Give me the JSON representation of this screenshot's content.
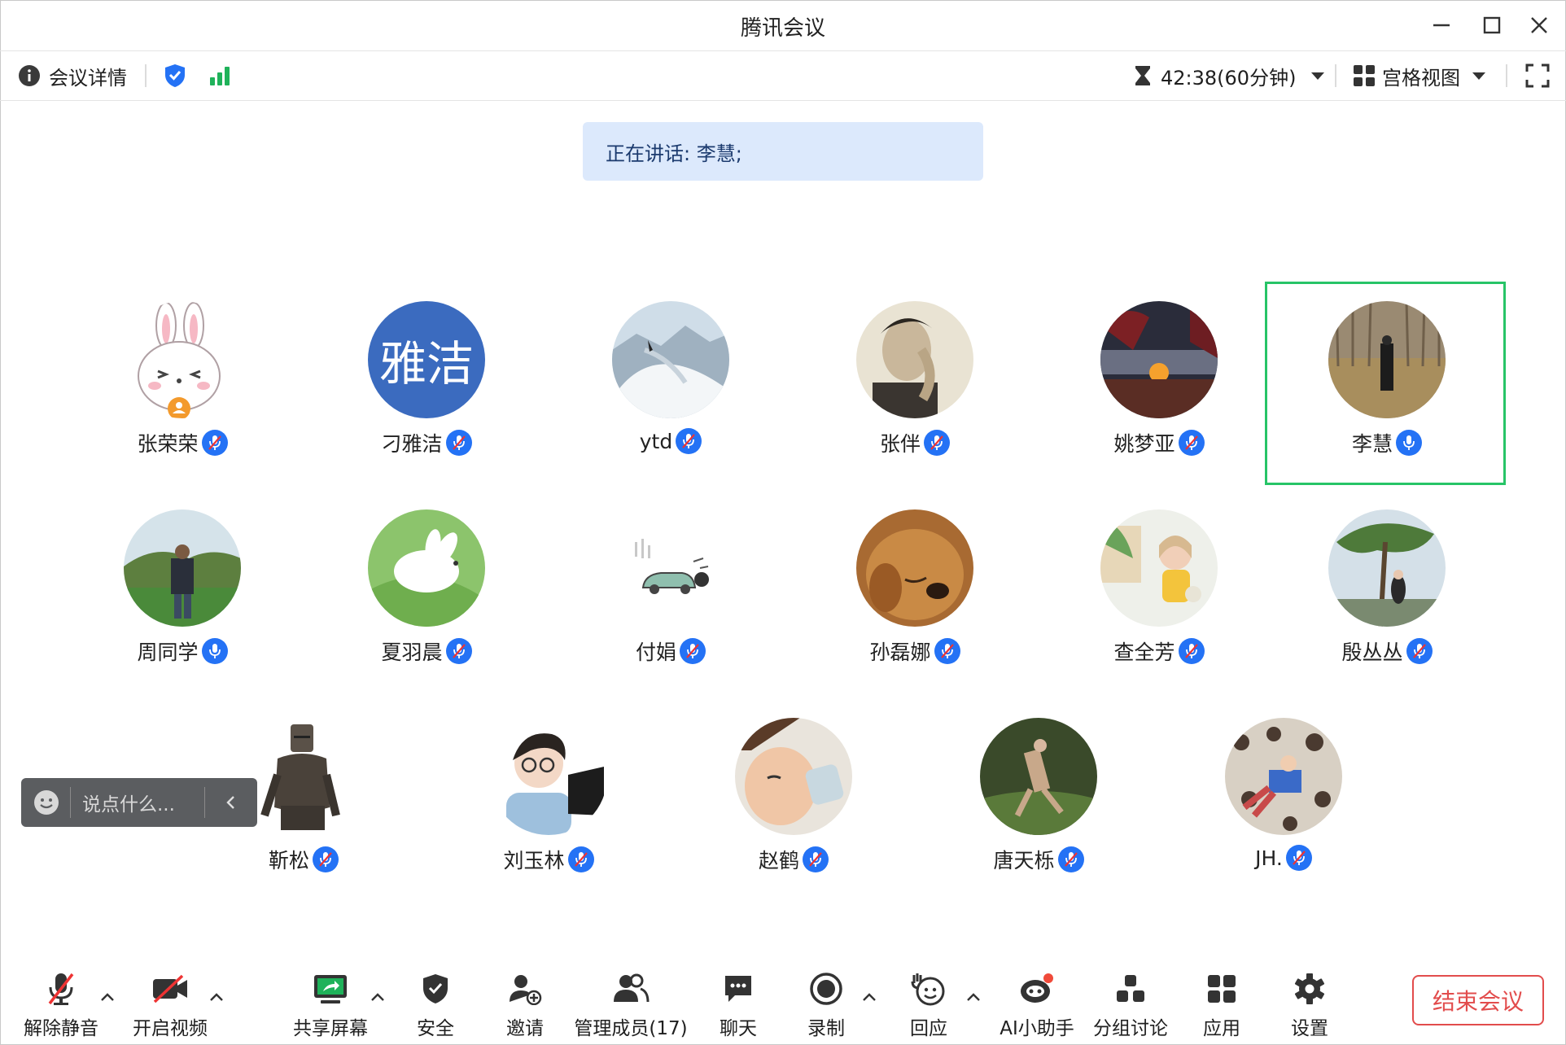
{
  "window": {
    "title": "腾讯会议"
  },
  "topbar": {
    "meeting_details": "会议详情",
    "timer": "42:38(60分钟)",
    "view_mode": "宫格视图"
  },
  "speaking": {
    "text": "正在讲话: 李慧;"
  },
  "participants": [
    {
      "name": "张荣荣",
      "mic": "muted",
      "avatar": "cartoon-rabbit"
    },
    {
      "name": "刁雅洁",
      "mic": "muted",
      "avatar": "text",
      "avatar_text": "雅洁",
      "avatar_color": "#3b6bbf"
    },
    {
      "name": "ytd",
      "mic": "muted",
      "avatar": "snow-mountain"
    },
    {
      "name": "张伴",
      "mic": "muted",
      "avatar": "man-portrait"
    },
    {
      "name": "姚梦亚",
      "mic": "muted",
      "avatar": "sunset"
    },
    {
      "name": "李慧",
      "mic": "on",
      "avatar": "forest-person",
      "active_speaker": true
    },
    {
      "name": "周同学",
      "mic": "on",
      "avatar": "field-man"
    },
    {
      "name": "夏羽晨",
      "mic": "muted",
      "avatar": "rabbit-grass"
    },
    {
      "name": "付娟",
      "mic": "muted",
      "avatar": "car-sketch"
    },
    {
      "name": "孙磊娜",
      "mic": "muted",
      "avatar": "dog"
    },
    {
      "name": "查全芳",
      "mic": "muted",
      "avatar": "baby"
    },
    {
      "name": "殷丛丛",
      "mic": "muted",
      "avatar": "tree-girl"
    },
    {
      "name": "靳松",
      "mic": "muted",
      "avatar": "knight"
    },
    {
      "name": "刘玉林",
      "mic": "muted",
      "avatar": "girl-laptop"
    },
    {
      "name": "赵鹤",
      "mic": "muted",
      "avatar": "child-drinking"
    },
    {
      "name": "唐天栎",
      "mic": "muted",
      "avatar": "dancer"
    },
    {
      "name": "JH.",
      "mic": "muted",
      "avatar": "kid-sofa"
    }
  ],
  "chat_input": {
    "placeholder": "说点什么..."
  },
  "bottombar": {
    "unmute": "解除静音",
    "start_video": "开启视频",
    "share_screen": "共享屏幕",
    "security": "安全",
    "invite": "邀请",
    "manage_members": "管理成员(17)",
    "chat": "聊天",
    "record": "录制",
    "react": "回应",
    "ai_assistant": "AI小助手",
    "breakout": "分组讨论",
    "apps": "应用",
    "settings": "设置",
    "end_meeting": "结束会议"
  },
  "colors": {
    "accent_blue": "#2472f5",
    "active_green": "#27c467",
    "end_red": "#e24c4c",
    "speaking_bg": "#dce9fc",
    "signal_green": "#1fb25a"
  }
}
